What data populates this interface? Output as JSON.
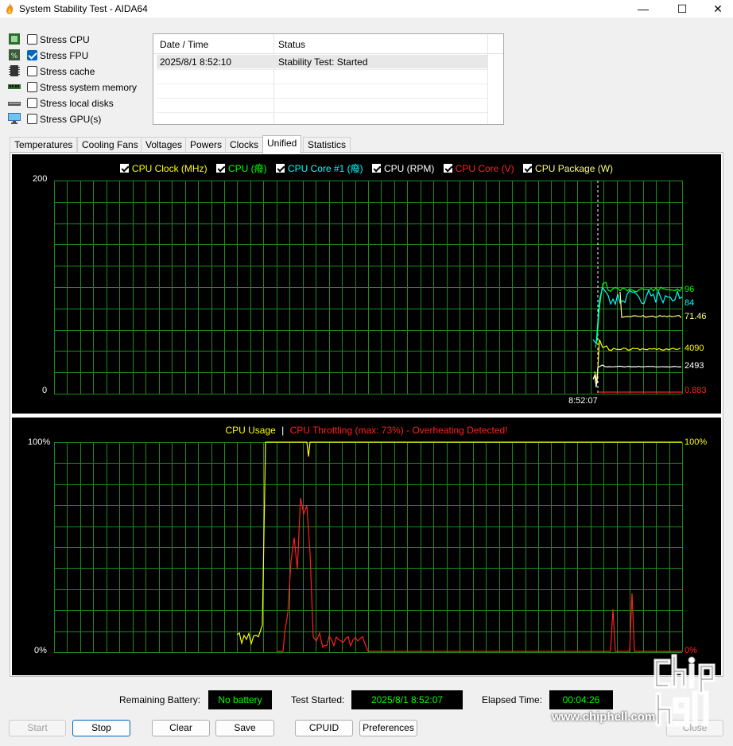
{
  "window": {
    "title": "System Stability Test - AIDA64",
    "minimize": "—",
    "maximize": "☐",
    "close": "✕"
  },
  "stress_options": [
    {
      "label": "Stress CPU",
      "checked": false,
      "icon": "cpu-chip-icon"
    },
    {
      "label": "Stress FPU",
      "checked": true,
      "icon": "fpu-percent-icon"
    },
    {
      "label": "Stress cache",
      "checked": false,
      "icon": "cache-chip-icon"
    },
    {
      "label": "Stress system memory",
      "checked": false,
      "icon": "memory-module-icon"
    },
    {
      "label": "Stress local disks",
      "checked": false,
      "icon": "disk-drive-icon"
    },
    {
      "label": "Stress GPU(s)",
      "checked": false,
      "icon": "monitor-icon"
    }
  ],
  "log": {
    "headers": [
      "Date / Time",
      "Status"
    ],
    "rows": [
      {
        "datetime": "2025/8/1 8:52:10",
        "status": "Stability Test: Started"
      }
    ]
  },
  "tabs": [
    "Temperatures",
    "Cooling Fans",
    "Voltages",
    "Powers",
    "Clocks",
    "Unified",
    "Statistics"
  ],
  "active_tab": "Unified",
  "unified_graph": {
    "legend": [
      {
        "label": "CPU Clock (MHz)",
        "color": "#ffff00"
      },
      {
        "label": "CPU (癈)",
        "color": "#00ff00"
      },
      {
        "label": "CPU Core #1 (癈)",
        "color": "#00ffff"
      },
      {
        "label": "CPU (RPM)",
        "color": "#ffffff"
      },
      {
        "label": "CPU Core (V)",
        "color": "#ff2020"
      },
      {
        "label": "CPU Package (W)",
        "color": "#ffff80"
      }
    ],
    "y_max_label": "200",
    "y_min_label": "0",
    "time_label": "8:52:07",
    "current_values": [
      {
        "value": "96",
        "color": "#00ff00"
      },
      {
        "value": "84",
        "color": "#00ffff"
      },
      {
        "value": "71.46",
        "color": "#ffff80"
      },
      {
        "value": "4090",
        "color": "#ffff00"
      },
      {
        "value": "2493",
        "color": "#ffffff"
      },
      {
        "value": "0.883",
        "color": "#ff2020"
      }
    ]
  },
  "usage_graph": {
    "title_usage": "CPU Usage",
    "title_sep": "|",
    "title_throttle": "CPU Throttling (max: 73%) - Overheating Detected!",
    "usage_color": "#ffff00",
    "throttle_color": "#ff2020",
    "y_max_label": "100%",
    "y_min_label": "0%",
    "current_usage": "100%",
    "current_throttle": "0%"
  },
  "status_bar": {
    "battery_label": "Remaining Battery:",
    "battery_value": "No battery",
    "started_label": "Test Started:",
    "started_value": "2025/8/1 8:52:07",
    "elapsed_label": "Elapsed Time:",
    "elapsed_value": "00:04:26"
  },
  "buttons": {
    "start": "Start",
    "stop": "Stop",
    "clear": "Clear",
    "save": "Save",
    "cpuid": "CPUID",
    "preferences": "Preferences",
    "close": "Close"
  },
  "watermark": {
    "url": "www.chiphell.com"
  }
}
